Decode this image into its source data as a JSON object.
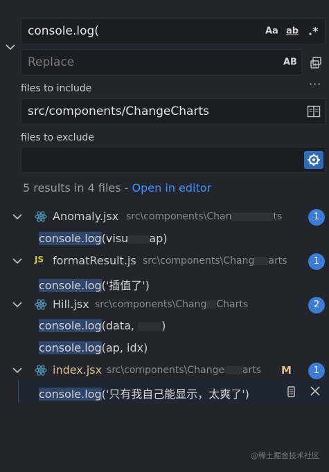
{
  "search": {
    "find_value": "console.log(",
    "match_case_label": "Aa",
    "whole_word_label": "ab",
    "regex_label": ".*",
    "replace_placeholder": "Replace",
    "preserve_case_label": "AB",
    "include_label": "files to include",
    "include_value": "src/components/ChangeCharts",
    "exclude_label": "files to exclude",
    "exclude_value": ""
  },
  "summary": {
    "text": "5 results in 4 files - ",
    "link": "Open in editor"
  },
  "files": [
    {
      "icon": "react-icon",
      "name": "Anomaly.jsx",
      "path": "src\\components\\Chan",
      "path_tail": "ts",
      "count": "1",
      "matches": [
        {
          "hl": "console.log",
          "rest": "(visu",
          "tail": "ap)"
        }
      ]
    },
    {
      "icon": "js-icon",
      "name": "formatResult.js",
      "path": "src\\components\\Chang",
      "path_tail": "arts",
      "count": "1",
      "matches": [
        {
          "hl": "console.log",
          "rest": "('插值了')",
          "tail": ""
        }
      ]
    },
    {
      "icon": "react-icon",
      "name": "Hill.jsx",
      "path": "src\\components\\Chang",
      "path_tail": "Charts",
      "count": "2",
      "matches": [
        {
          "hl": "console.log",
          "rest": "(data, ",
          "tail": ")"
        },
        {
          "hl": "console.log",
          "rest": "(ap, idx)",
          "tail": ""
        }
      ]
    },
    {
      "icon": "react-icon",
      "name": "index.jsx",
      "path": "src\\components\\Change",
      "path_tail": "arts",
      "status": "M",
      "count": "1",
      "matches": [
        {
          "hl": "console.log",
          "rest": "('只有我自己能显示，太爽了')",
          "tail": ""
        }
      ]
    }
  ],
  "colors": {
    "accent": "#3794ff",
    "badge": "#3c7bd6",
    "modified": "#e2c08d",
    "js": "#cbcb41",
    "react": "#519aba"
  },
  "watermark": "@稀土掘金技术社区"
}
